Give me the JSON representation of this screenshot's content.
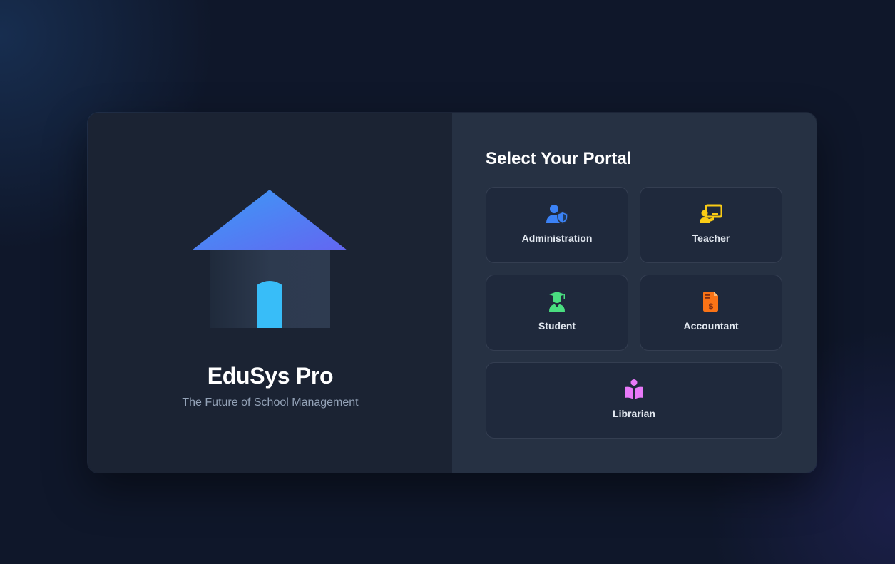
{
  "brand": {
    "name": "EduSys Pro",
    "tagline": "The Future of School Management",
    "icon": "school-house-icon"
  },
  "portal": {
    "heading": "Select Your Portal",
    "options": [
      {
        "label": "Administration",
        "icon": "user-shield-icon",
        "color": "#3b82f6"
      },
      {
        "label": "Teacher",
        "icon": "chalkboard-teacher-icon",
        "color": "#facc15"
      },
      {
        "label": "Student",
        "icon": "user-graduate-icon",
        "color": "#4ade80"
      },
      {
        "label": "Accountant",
        "icon": "file-invoice-dollar-icon",
        "color": "#f97316"
      },
      {
        "label": "Librarian",
        "icon": "book-reader-icon",
        "color": "#e879f9"
      }
    ]
  },
  "colors": {
    "background": "#0f172a",
    "brand_panel": "#1b2333",
    "portal_panel": "#263143",
    "roof_gradient_start": "#3b9cf6",
    "roof_gradient_end": "#6366f1",
    "door": "#38bdf8"
  }
}
